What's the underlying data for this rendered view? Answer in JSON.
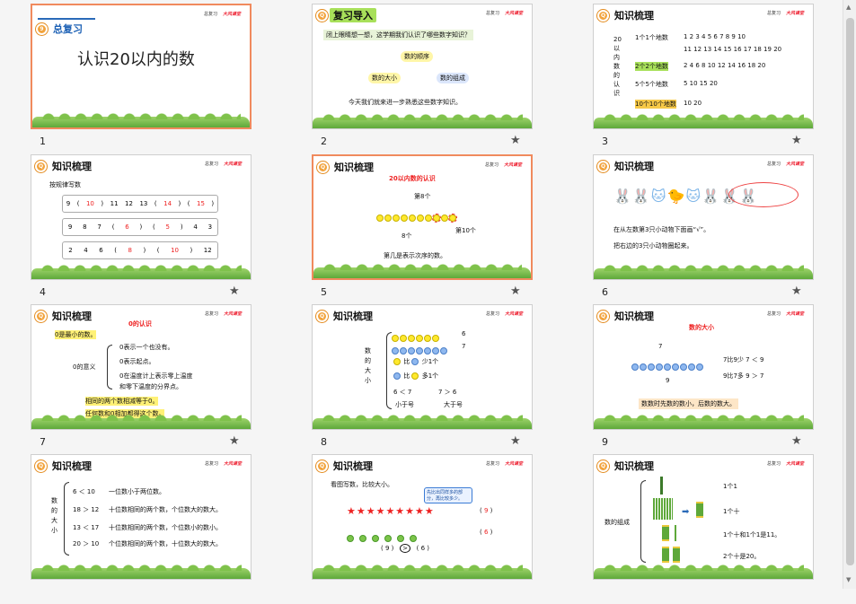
{
  "slides": [
    {
      "num": "1",
      "badge": "9",
      "header": "总复习",
      "title": "认识20以内的数"
    },
    {
      "num": "2",
      "header": "复习导入",
      "q": "闭上眼睛想一想，这学期我们认识了哪些数字知识？",
      "a": "数的顺序",
      "b": "数的大小",
      "c": "数的组成",
      "d": "今天我们就来进一步熟悉这些数字知识。"
    },
    {
      "num": "3",
      "header": "知识梳理",
      "side": "20以内数的认识",
      "rows": [
        {
          "k": "1个1个地数",
          "v": "1 2 3 4 5 6 7 8 9 10"
        },
        {
          "k": "",
          "v": "11 12 13 14 15 16 17 18 19 20"
        },
        {
          "k": "2个2个地数",
          "v": "2 4 6 8 10 12 14 16 18 20"
        },
        {
          "k": "5个5个地数",
          "v": "5 10 15 20"
        },
        {
          "k": "10个10个地数",
          "v": "10 20"
        }
      ]
    },
    {
      "num": "4",
      "header": "知识梳理",
      "sub": "按规律写数",
      "r1": [
        "9",
        "(",
        "10",
        ")",
        "11",
        "12",
        "13",
        "(",
        "14",
        ")",
        "(",
        "15",
        ")"
      ],
      "r2": [
        "9",
        "8",
        "7",
        "(",
        "6",
        ")",
        "(",
        "5",
        ")",
        "4",
        "3"
      ],
      "r3": [
        "2",
        "4",
        "6",
        "(",
        "8",
        ")",
        "(",
        "10",
        ")",
        "12"
      ]
    },
    {
      "num": "5",
      "header": "知识梳理",
      "sub": "20以内数的认识",
      "l1": "第8个",
      "l2": "第10个",
      "l3": "8个",
      "l4": "第几是表示次序的数。"
    },
    {
      "num": "6",
      "header": "知识梳理",
      "l1": "在从左数第3只小动物下面画“√”。",
      "l2": "把右边的3只小动物圈起来。"
    },
    {
      "num": "7",
      "header": "知识梳理",
      "sub": "0的认识",
      "a": "0是最小的数。",
      "b": "0的意义",
      "c": "0表示一个也没有。",
      "d": "0表示起点。",
      "e": "0在温度计上表示零上温度",
      "f": "和零下温度的分界点。",
      "g": "相同的两个数相减等于0。",
      "h": "任何数和0相加都得这个数。"
    },
    {
      "num": "8",
      "header": "知识梳理",
      "side": "数的大小",
      "n1": "6",
      "n2": "7",
      "b1": "比",
      "b2": "少1个",
      "b3": "比",
      "b4": "多1个",
      "c1": "6 ＜ 7",
      "c2": "7 ＞ 6",
      "c3": "小于号",
      "c4": "大于号"
    },
    {
      "num": "9",
      "header": "知识梳理",
      "sub": "数的大小",
      "top": "7",
      "bot": "9",
      "r1": "7比9少  7 ＜ 9",
      "r2": "9比7多  9 ＞ 7",
      "foot": "数数时先数的数小，后数的数大。"
    },
    {
      "num": "",
      "header": "知识梳理",
      "side": "数的大小",
      "rows": [
        {
          "k": "6 ＜ 10",
          "v": "一位数小于两位数。"
        },
        {
          "k": "18 ＞ 12",
          "v": "十位数相同的两个数，个位数大的数大。"
        },
        {
          "k": "13 ＜ 17",
          "v": "十位数相同的两个数，个位数小的数小。"
        },
        {
          "k": "20 ＞ 10",
          "v": "个位数相同的两个数，十位数大的数大。"
        }
      ]
    },
    {
      "num": "",
      "header": "知识梳理",
      "sub": "看图写数，比较大小。",
      "tip": "先比出同样多的部分，再比较多少。",
      "a": "9",
      "b": "6",
      "c": "9",
      "d": ">",
      "e": "6"
    },
    {
      "num": "",
      "header": "知识梳理",
      "side": "数的组成",
      "r1": "1个1",
      "r2": "1个十",
      "r3": "1个十和1个1是11。",
      "r4": "2个十是20。"
    }
  ],
  "logo": {
    "a": "总复习",
    "b": "大风课堂"
  },
  "star": "★"
}
